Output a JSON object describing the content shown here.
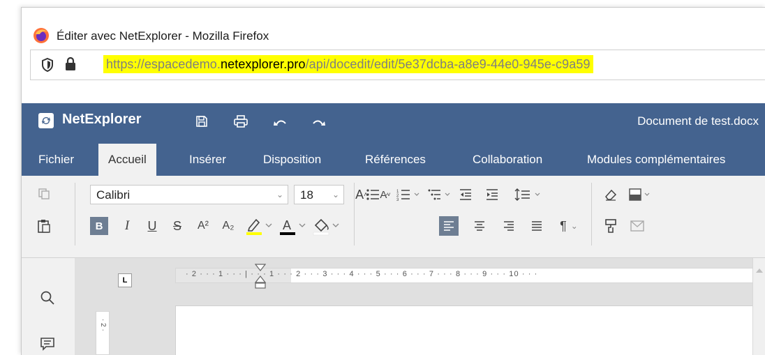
{
  "window": {
    "title": "Éditer avec NetExplorer - Mozilla Firefox"
  },
  "urlbar": {
    "url_prefix": "https://espacedemo.",
    "url_domain": "netexplorer.pro",
    "url_suffix": "/api/docedit/edit/5e37dcba-a8e9-44e0-945e-c9a59",
    "highlight_color": "#ffff00"
  },
  "app": {
    "brand": "NetExplorer",
    "document_name": "Document de test.docx",
    "accent_color": "#44638f"
  },
  "tabs": [
    {
      "label": "Fichier"
    },
    {
      "label": "Accueil",
      "active": true
    },
    {
      "label": "Insérer"
    },
    {
      "label": "Disposition"
    },
    {
      "label": "Références"
    },
    {
      "label": "Collaboration"
    },
    {
      "label": "Modules complémentaires"
    }
  ],
  "ribbon": {
    "font_name": "Calibri",
    "font_size": "18",
    "bold": "B",
    "italic": "I",
    "underline": "U",
    "strike": "S",
    "superscript": "A²",
    "subscript": "A₂",
    "grow_font": "A",
    "shrink_font": "A",
    "font_color_letter": "A",
    "pilcrow": "¶",
    "highlight_color": "#ffff00",
    "font_color": "#000000"
  },
  "ruler": {
    "labels": "· 2 · · · 1 · · · | · · · 1 · · · 2 · · · 3 · · · 4 · · · 5 · · · 6 · · · 7 · · · 8 · · · 9 · · · 10 · · ·",
    "vertical_label": "· 2 ·",
    "tab_stop": "L"
  }
}
